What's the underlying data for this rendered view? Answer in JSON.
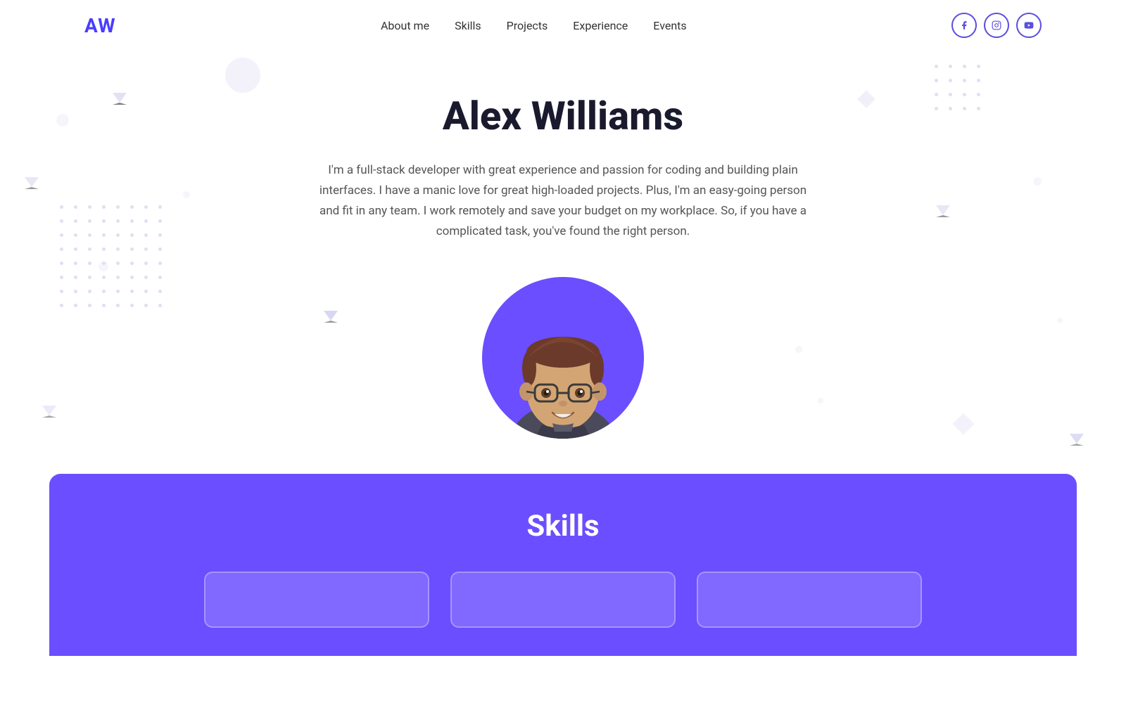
{
  "nav": {
    "logo": "AW",
    "links": [
      {
        "label": "About me",
        "id": "about-me"
      },
      {
        "label": "Skills",
        "id": "skills"
      },
      {
        "label": "Projects",
        "id": "projects"
      },
      {
        "label": "Experience",
        "id": "experience"
      },
      {
        "label": "Events",
        "id": "events"
      }
    ],
    "social": [
      {
        "icon": "f",
        "name": "facebook"
      },
      {
        "icon": "in",
        "name": "instagram"
      },
      {
        "icon": "▶",
        "name": "youtube"
      }
    ]
  },
  "hero": {
    "title": "Alex Williams",
    "bio": "I'm a full-stack developer with great experience and passion for coding and building plain interfaces. I have a manic love for great high-loaded projects. Plus, I'm an easy-going person and fit in any team. I work remotely and save your budget on my workplace. So, if you have a complicated task, you've found the right person."
  },
  "skills": {
    "title": "Skills"
  },
  "colors": {
    "accent": "#6B4EFF",
    "logo": "#4A3DFF"
  }
}
